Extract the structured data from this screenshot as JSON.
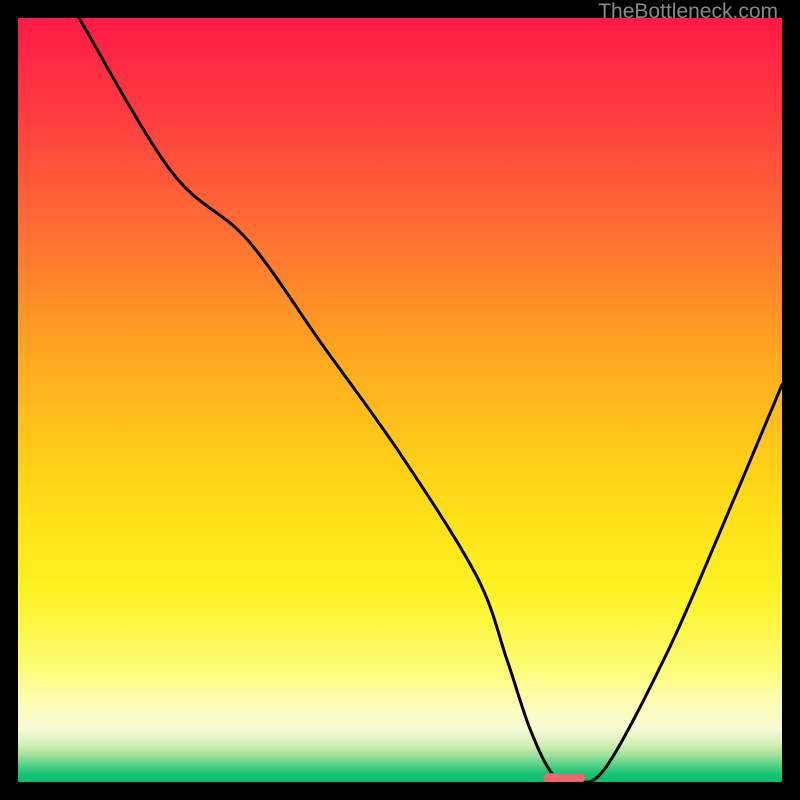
{
  "watermark": "TheBottleneck.com",
  "chart_data": {
    "type": "line",
    "title": "",
    "xlabel": "",
    "ylabel": "",
    "xlim": [
      0,
      100
    ],
    "ylim": [
      0,
      100
    ],
    "x": [
      8,
      20,
      30,
      40,
      50,
      60,
      64,
      67,
      70,
      73,
      77,
      85,
      92,
      100
    ],
    "values": [
      100,
      80,
      71,
      57,
      43,
      27,
      16,
      7,
      1,
      0,
      2,
      17,
      33,
      52
    ],
    "optimal_marker": {
      "x": 71.5,
      "y": 0.5,
      "width": 5.5,
      "color": "#e66a6d"
    },
    "background_gradient": {
      "stops": [
        {
          "pos": 0.0,
          "color": "#ff1a47"
        },
        {
          "pos": 0.12,
          "color": "#ff3a3f"
        },
        {
          "pos": 0.28,
          "color": "#ff6f33"
        },
        {
          "pos": 0.45,
          "color": "#ffaa1f"
        },
        {
          "pos": 0.62,
          "color": "#ffd916"
        },
        {
          "pos": 0.75,
          "color": "#fef222"
        },
        {
          "pos": 0.85,
          "color": "#fcfc74"
        },
        {
          "pos": 0.9,
          "color": "#fdfdb8"
        },
        {
          "pos": 0.93,
          "color": "#f7fad5"
        },
        {
          "pos": 0.95,
          "color": "#d5f0b6"
        },
        {
          "pos": 0.965,
          "color": "#9ee29a"
        },
        {
          "pos": 0.978,
          "color": "#50d187"
        },
        {
          "pos": 0.99,
          "color": "#13c574"
        },
        {
          "pos": 1.0,
          "color": "#00bf6f"
        }
      ]
    }
  }
}
